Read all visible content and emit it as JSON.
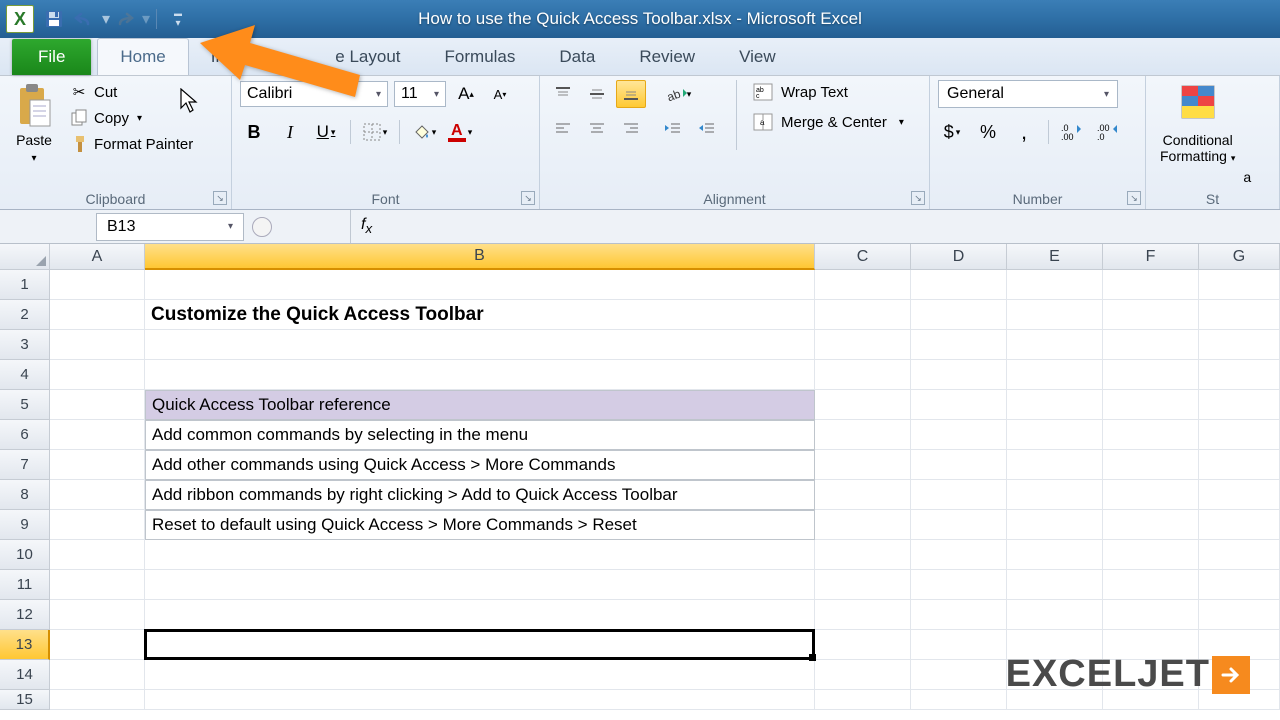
{
  "title": "How to use the Quick Access Toolbar.xlsx - Microsoft Excel",
  "tabs": {
    "file": "File",
    "home": "Home",
    "insert": "Insert",
    "page_layout": "e Layout",
    "formulas": "Formulas",
    "data": "Data",
    "review": "Review",
    "view": "View"
  },
  "clipboard": {
    "paste": "Paste",
    "cut": "Cut",
    "copy": "Copy",
    "format_painter": "Format Painter",
    "label": "Clipboard"
  },
  "font": {
    "name": "Calibri",
    "size": "11",
    "label": "Font"
  },
  "alignment": {
    "wrap": "Wrap Text",
    "merge": "Merge & Center",
    "label": "Alignment"
  },
  "number": {
    "format": "General",
    "label": "Number"
  },
  "styles": {
    "cond": "Conditional",
    "fmtting": "Formatting",
    "label": "St"
  },
  "namebox": "B13",
  "cols": [
    "A",
    "B",
    "C",
    "D",
    "E",
    "F",
    "G"
  ],
  "rows": [
    "1",
    "2",
    "3",
    "4",
    "5",
    "6",
    "7",
    "8",
    "9",
    "10",
    "11",
    "12",
    "13",
    "14",
    "15"
  ],
  "cell_b2": "Customize the Quick Access Toolbar",
  "cell_b5": "Quick Access Toolbar reference",
  "cell_b6": "Add common commands by selecting in the menu",
  "cell_b7": "Add other commands using Quick Access > More Commands",
  "cell_b8": "Add ribbon commands by right clicking > Add to Quick Access Toolbar",
  "cell_b9": "Reset to default using Quick Access > More Commands > Reset",
  "logo": "EXCELJET"
}
